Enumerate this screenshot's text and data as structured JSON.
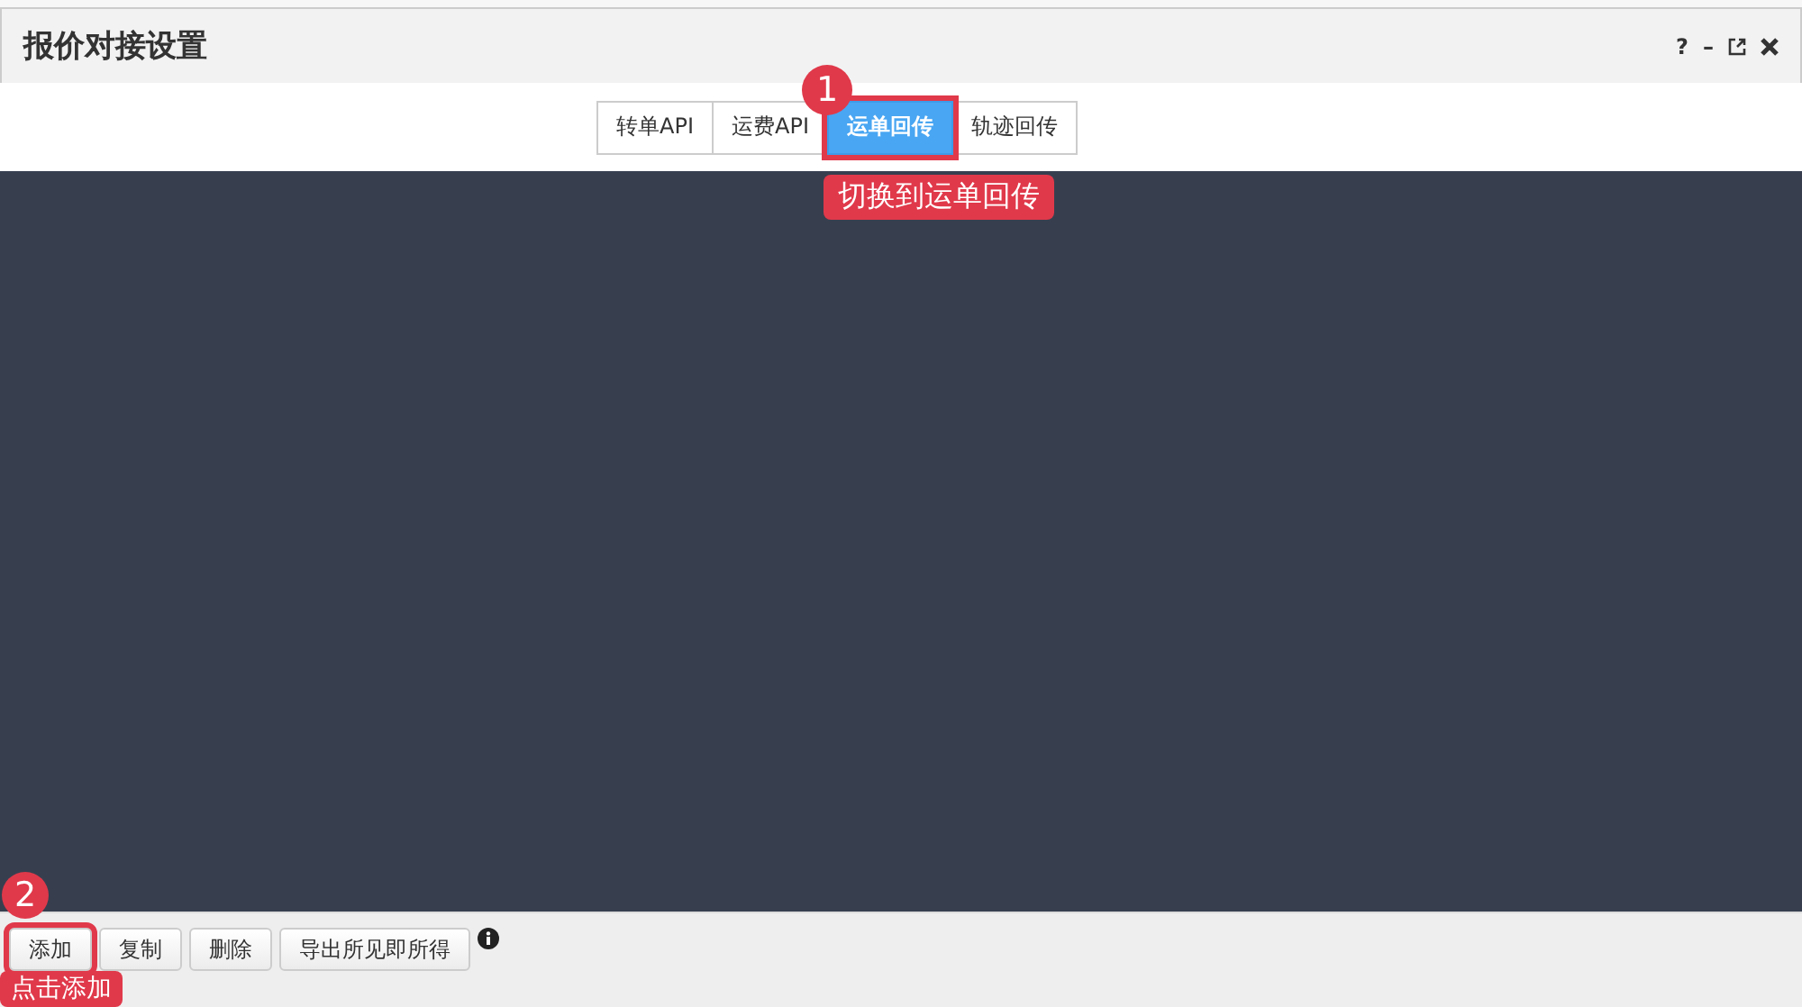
{
  "dialog": {
    "title": "报价对接设置",
    "header_buttons": [
      "?",
      "–"
    ]
  },
  "tabs": [
    {
      "label": "转单API",
      "selected": false
    },
    {
      "label": "运费API",
      "selected": false
    },
    {
      "label": "运单回传",
      "selected": true
    },
    {
      "label": "轨迹回传",
      "selected": false
    }
  ],
  "footer_buttons": [
    "添加",
    "复制",
    "删除",
    "导出所见即所得"
  ],
  "annotations": [
    {
      "number": "1",
      "text": "切换到运单回传"
    },
    {
      "number": "2",
      "text": "点击添加"
    }
  ]
}
